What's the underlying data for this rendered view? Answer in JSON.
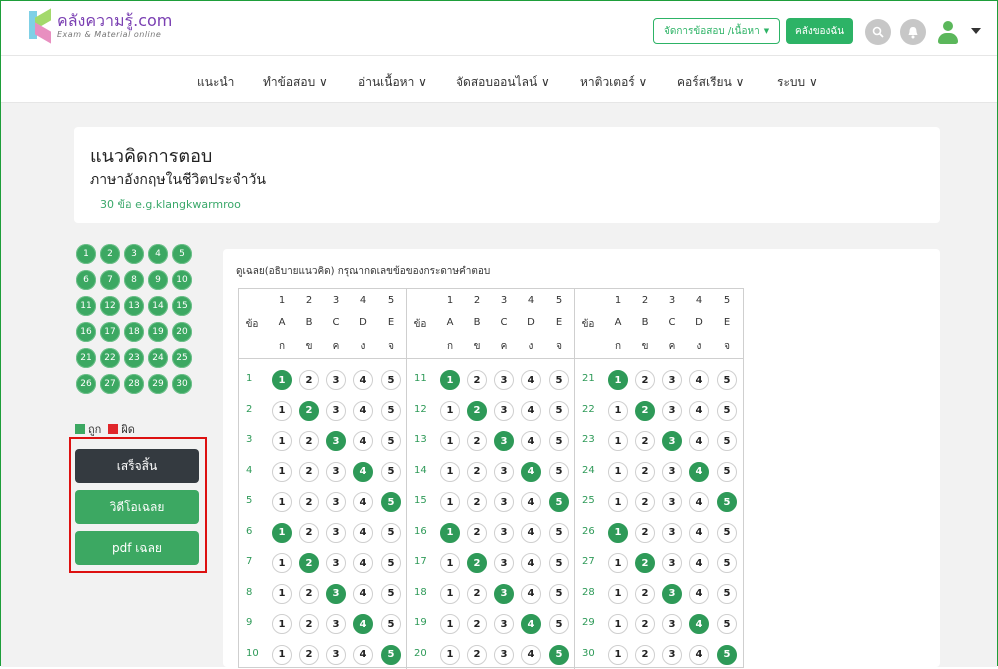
{
  "header": {
    "logo_title": "คลังความรู้.com",
    "logo_sub": "Exam & Material online",
    "manage_label": "จัดการข้อสอบ /เนื้อหา",
    "shelf_label": "คลังของฉัน"
  },
  "nav": {
    "items": [
      {
        "label": "แนะนำ"
      },
      {
        "label": "ทำข้อสอบ ∨"
      },
      {
        "label": "อ่านเนื้อหา ∨"
      },
      {
        "label": "จัดสอบออนไลน์ ∨"
      },
      {
        "label": "หาติวเตอร์ ∨"
      },
      {
        "label": "คอร์สเรียน ∨"
      },
      {
        "label": "ระบบ ∨"
      }
    ]
  },
  "page": {
    "title": "แนวคิดการตอบ",
    "subtitle": "ภาษาอังกฤษในชีวิตประจำวัน",
    "meta": "30 ข้อ   e.g.klangkwarmroo"
  },
  "sidebar": {
    "questions": [
      "1",
      "2",
      "3",
      "4",
      "5",
      "6",
      "7",
      "8",
      "9",
      "10",
      "11",
      "12",
      "13",
      "14",
      "15",
      "16",
      "17",
      "18",
      "19",
      "20",
      "21",
      "22",
      "23",
      "24",
      "25",
      "26",
      "27",
      "28",
      "29",
      "30"
    ],
    "legend_correct": "ถูก",
    "legend_wrong": "ผิด",
    "legend_correct_color": "#3ca862",
    "legend_wrong_color": "#e0262b",
    "finish_label": "เสร็จสิ้น",
    "video_label": "วิดีโอเฉลย",
    "pdf_label": "pdf เฉลย"
  },
  "answers": {
    "hint": "ดูเฉลย(อธิบายแนวคิด) กรุณากดเลขข้อของกระดาษคำตอบ",
    "header_item": "ข้อ",
    "header_nums": [
      "1",
      "2",
      "3",
      "4",
      "5"
    ],
    "header_en": [
      "A",
      "B",
      "C",
      "D",
      "E"
    ],
    "header_th": [
      "ก",
      "ข",
      "ค",
      "ง",
      "จ"
    ],
    "options": [
      "1",
      "2",
      "3",
      "4",
      "5"
    ],
    "rows": [
      {
        "n": "1",
        "a": 1
      },
      {
        "n": "2",
        "a": 2
      },
      {
        "n": "3",
        "a": 3
      },
      {
        "n": "4",
        "a": 4
      },
      {
        "n": "5",
        "a": 5
      },
      {
        "n": "6",
        "a": 1
      },
      {
        "n": "7",
        "a": 2
      },
      {
        "n": "8",
        "a": 3
      },
      {
        "n": "9",
        "a": 4
      },
      {
        "n": "10",
        "a": 5
      },
      {
        "n": "11",
        "a": 1
      },
      {
        "n": "12",
        "a": 2
      },
      {
        "n": "13",
        "a": 3
      },
      {
        "n": "14",
        "a": 4
      },
      {
        "n": "15",
        "a": 5
      },
      {
        "n": "16",
        "a": 1
      },
      {
        "n": "17",
        "a": 2
      },
      {
        "n": "18",
        "a": 3
      },
      {
        "n": "19",
        "a": 4
      },
      {
        "n": "20",
        "a": 5
      },
      {
        "n": "21",
        "a": 1
      },
      {
        "n": "22",
        "a": 2
      },
      {
        "n": "23",
        "a": 3
      },
      {
        "n": "24",
        "a": 4
      },
      {
        "n": "25",
        "a": 5
      },
      {
        "n": "26",
        "a": 1
      },
      {
        "n": "27",
        "a": 2
      },
      {
        "n": "28",
        "a": 3
      },
      {
        "n": "29",
        "a": 4
      },
      {
        "n": "30",
        "a": 5
      }
    ]
  },
  "colors": {
    "accent": "#2db366",
    "correct": "#2e9a58",
    "dark_button": "#343a40",
    "highlight_border": "#dd1111"
  }
}
